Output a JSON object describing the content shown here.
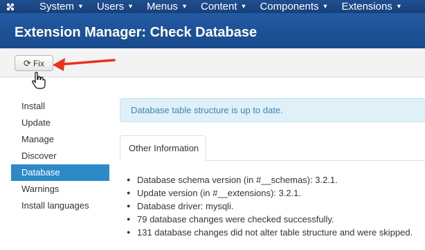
{
  "navbar": {
    "logo_icon": "joomla-logo-icon",
    "items": [
      {
        "label": "System"
      },
      {
        "label": "Users"
      },
      {
        "label": "Menus"
      },
      {
        "label": "Content"
      },
      {
        "label": "Components"
      },
      {
        "label": "Extensions"
      }
    ]
  },
  "header": {
    "title": "Extension Manager: Check Database"
  },
  "toolbar": {
    "fix_label": "Fix",
    "fix_icon": "refresh-icon"
  },
  "sidebar": {
    "items": [
      {
        "label": "Install"
      },
      {
        "label": "Update"
      },
      {
        "label": "Manage"
      },
      {
        "label": "Discover"
      },
      {
        "label": "Database",
        "active": true
      },
      {
        "label": "Warnings"
      },
      {
        "label": "Install languages"
      }
    ]
  },
  "main": {
    "alert": "Database table structure is up to date.",
    "tab": "Other Information",
    "info": [
      "Database schema version (in #__schemas): 3.2.1.",
      "Update version (in #__extensions): 3.2.1.",
      "Database driver: mysqli.",
      "79 database changes were checked successfully.",
      "131 database changes did not alter table structure and were skipped."
    ]
  },
  "colors": {
    "navbar": "#1f4f90",
    "header": "#235aa3",
    "active_sidebar": "#2d8ac7",
    "alert_bg": "#dff0f8",
    "alert_text": "#3a87ad",
    "annotation_arrow": "#e8321e"
  }
}
